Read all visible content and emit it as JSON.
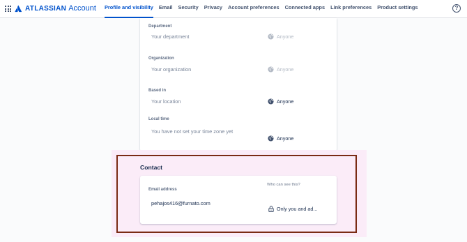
{
  "header": {
    "brand": "ATLASSIAN",
    "product": "Account",
    "nav": [
      {
        "label": "Profile and visibility",
        "active": true
      },
      {
        "label": "Email",
        "active": false
      },
      {
        "label": "Security",
        "active": false
      },
      {
        "label": "Privacy",
        "active": false
      },
      {
        "label": "Account preferences",
        "active": false
      },
      {
        "label": "Connected apps",
        "active": false
      },
      {
        "label": "Link preferences",
        "active": false
      },
      {
        "label": "Product settings",
        "active": false
      }
    ],
    "help_glyph": "?"
  },
  "profile": {
    "fields": [
      {
        "label": "Department",
        "placeholder": "Your department",
        "visibility": "Anyone",
        "visibility_enabled": false,
        "icon": "globe-icon"
      },
      {
        "label": "Organization",
        "placeholder": "Your organization",
        "visibility": "Anyone",
        "visibility_enabled": false,
        "icon": "globe-icon"
      },
      {
        "label": "Based in",
        "placeholder": "Your location",
        "visibility": "Anyone",
        "visibility_enabled": true,
        "icon": "globe-icon"
      },
      {
        "label": "Local time",
        "placeholder": "You have not set your time zone yet",
        "visibility": "Anyone",
        "visibility_enabled": true,
        "icon": "globe-icon"
      }
    ]
  },
  "contact": {
    "title": "Contact",
    "who_can_see": "Who can see this?",
    "email_label": "Email address",
    "email_value": "pehajos416@furnato.com",
    "visibility": "Only you and ad...",
    "icon": "lock-icon"
  },
  "colors": {
    "accent": "#0052cc",
    "highlight_bg": "#fbecf8",
    "annotation_frame": "#7a2b14"
  }
}
